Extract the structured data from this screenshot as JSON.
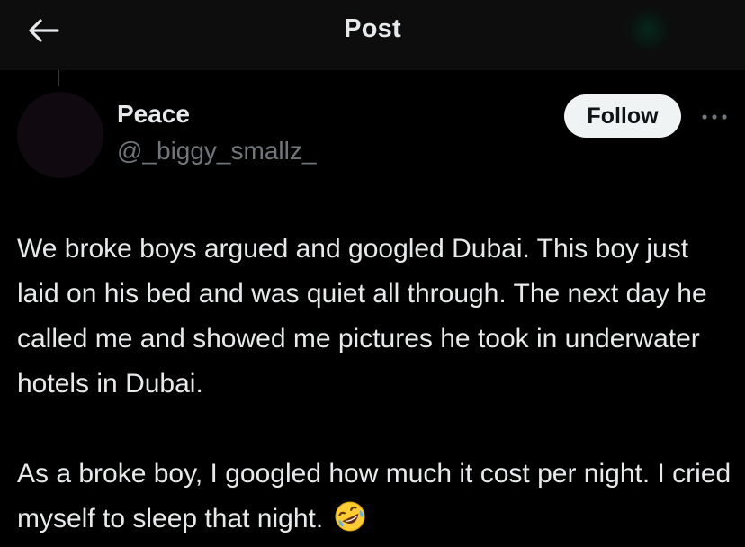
{
  "header": {
    "title": "Post",
    "back_icon": "arrow-left-icon"
  },
  "author": {
    "display_name": "Peace",
    "handle": "@_biggy_smallz_"
  },
  "actions": {
    "follow_label": "Follow",
    "more_icon": "more-horizontal-icon"
  },
  "post": {
    "paragraphs": [
      "We broke boys argued and googled Dubai. This boy just laid on his bed and was quiet all through. The next day he called me and showed me pictures he took in underwater hotels in Dubai.",
      "As a broke boy, I googled how much it cost per night. I cried myself to sleep that night."
    ],
    "trailing_emoji": "rolling-on-the-floor-laughing-emoji"
  },
  "colors": {
    "background": "#000000",
    "header_background": "#0d0d0d",
    "primary_text": "#e7e9ea",
    "secondary_text": "#71767b",
    "follow_button_bg": "#eff3f4",
    "follow_button_text": "#0f1419"
  }
}
